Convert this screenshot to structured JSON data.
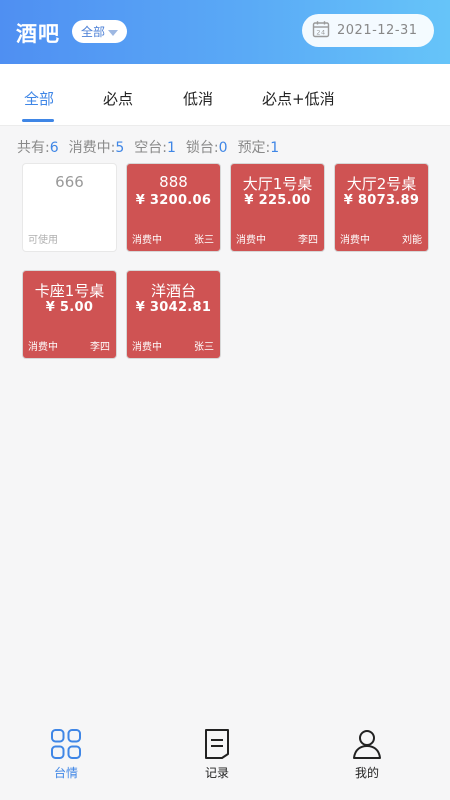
{
  "header": {
    "title": "酒吧",
    "filter_label": "全部",
    "date": "2021-12-31",
    "calendar_day": "24"
  },
  "tabs": [
    {
      "label": "全部",
      "active": true
    },
    {
      "label": "必点",
      "active": false
    },
    {
      "label": "低消",
      "active": false
    },
    {
      "label": "必点+低消",
      "active": false
    }
  ],
  "stats": [
    {
      "label": "共有:",
      "value": "6"
    },
    {
      "label": "消费中:",
      "value": "5"
    },
    {
      "label": "空台:",
      "value": "1"
    },
    {
      "label": "锁台:",
      "value": "0"
    },
    {
      "label": "预定:",
      "value": "1"
    }
  ],
  "tables": [
    {
      "name": "666",
      "amount": "",
      "status": "可使用",
      "person": ""
    },
    {
      "name": "888",
      "amount": "¥ 3200.06",
      "status": "消费中",
      "person": "张三"
    },
    {
      "name": "大厅1号桌",
      "amount": "¥ 225.00",
      "status": "消费中",
      "person": "李四"
    },
    {
      "name": "大厅2号桌",
      "amount": "¥ 8073.89",
      "status": "消费中",
      "person": "刘能"
    },
    {
      "name": "卡座1号桌",
      "amount": "¥ 5.00",
      "status": "消费中",
      "person": "李四"
    },
    {
      "name": "洋酒台",
      "amount": "¥ 3042.81",
      "status": "消费中",
      "person": "张三"
    }
  ],
  "nav": [
    {
      "label": "台情",
      "icon": "grid-icon",
      "active": true
    },
    {
      "label": "记录",
      "icon": "document-icon",
      "active": false
    },
    {
      "label": "我的",
      "icon": "user-icon",
      "active": false
    }
  ],
  "colors": {
    "accent": "#3f86e6",
    "occupied": "#cf5353",
    "header_start": "#4f8ff2",
    "header_end": "#66c4f9"
  }
}
